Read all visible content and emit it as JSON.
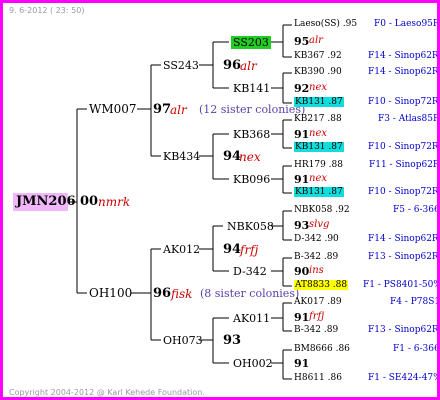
{
  "header": "9.  6-2012 ( 23: 50)",
  "copyright": "Copyright 2004-2012 @ Karl Kehede Foundation.",
  "root": {
    "name": "JMN206",
    "num": "00",
    "breeder": "nmrk"
  },
  "gen1": [
    {
      "name": "WM007",
      "num": "97",
      "breeder": "alr",
      "sisters": "(12 sister colonies)"
    },
    {
      "name": "OH100",
      "num": "96",
      "breeder": "fisk",
      "sisters": "(8 sister colonies)"
    }
  ],
  "gen2": [
    {
      "name": "SS243",
      "num": "96",
      "breeder": "alr"
    },
    {
      "name": "KB434",
      "num": "94",
      "breeder": "nex"
    },
    {
      "name": "AK012",
      "num": "94",
      "breeder": "frfj"
    },
    {
      "name": "OH073",
      "num": "93",
      "breeder": ""
    }
  ],
  "gen3": [
    {
      "name": "SS203",
      "num": "95",
      "breeder": "alr"
    },
    {
      "name": "KB141",
      "num": "92",
      "breeder": "nex"
    },
    {
      "name": "KB368",
      "num": "91",
      "breeder": "nex"
    },
    {
      "name": "KB096",
      "num": "91",
      "breeder": "nex"
    },
    {
      "name": "NBK058",
      "num": "93",
      "breeder": "slvg"
    },
    {
      "name": "D-342",
      "num": "90",
      "breeder": "ins"
    },
    {
      "name": "AK011",
      "num": "91",
      "breeder": "frfj"
    },
    {
      "name": "OH002",
      "num": "91",
      "breeder": ""
    }
  ],
  "leaves": [
    {
      "name": "Laeso(SS) .95",
      "line": "F0 - Laeso95R"
    },
    {
      "name": "KB367 .92",
      "line": "F14 - Sinop62R"
    },
    {
      "name": "KB390 .90",
      "line": "F14 - Sinop62R"
    },
    {
      "name": "KB131 .87",
      "line": "F10 - Sinop72R"
    },
    {
      "name": "KB217 .88",
      "line": "F3 - Atlas85R"
    },
    {
      "name": "KB131 .87",
      "line": "F10 - Sinop72R"
    },
    {
      "name": "HR179 .88",
      "line": "F11 - Sinop62R"
    },
    {
      "name": "KB131 .87",
      "line": "F10 - Sinop72R"
    },
    {
      "name": "NBK058 .92",
      "line": "F5 - 6-366"
    },
    {
      "name": "D-342 .90",
      "line": "F14 - Sinop62R"
    },
    {
      "name": "B-342 .89",
      "line": "F13 - Sinop62R"
    },
    {
      "name": "AT8833 .88",
      "line": "F1 - PS8401-50%"
    },
    {
      "name": "AK017 .89",
      "line": "F4 - P78S1"
    },
    {
      "name": "B-342 .89",
      "line": "F13 - Sinop62R"
    },
    {
      "name": "BM8666 .86",
      "line": "F1 - 6-366"
    },
    {
      "name": "H8611 .86",
      "line": "F1 - SE424-47%"
    }
  ]
}
